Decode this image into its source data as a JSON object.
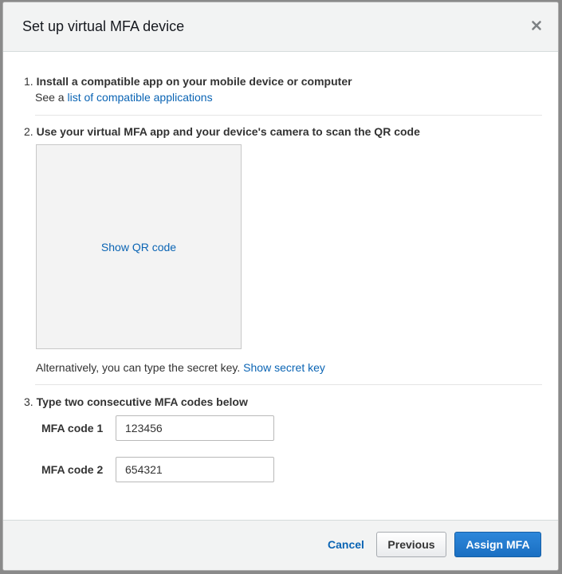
{
  "dialog": {
    "title": "Set up virtual MFA device",
    "close_icon": "close-icon"
  },
  "step1": {
    "number": "1.",
    "title": "Install a compatible app on your mobile device or computer",
    "see_prefix": "See a",
    "link_text": "list of compatible applications"
  },
  "step2": {
    "number": "2.",
    "title": "Use your virtual MFA app and your device's camera to scan the QR code",
    "show_qr_label": "Show QR code",
    "alt_text": "Alternatively, you can type the secret key.",
    "show_secret_label": "Show secret key"
  },
  "step3": {
    "number": "3.",
    "title": "Type two consecutive MFA codes below",
    "code1_label": "MFA code 1",
    "code1_value": "123456",
    "code2_label": "MFA code 2",
    "code2_value": "654321"
  },
  "footer": {
    "cancel_label": "Cancel",
    "previous_label": "Previous",
    "assign_label": "Assign MFA"
  },
  "colors": {
    "link": "#0a64b4",
    "primary_button": "#1a6fc2",
    "header_bg": "#f2f3f3"
  }
}
